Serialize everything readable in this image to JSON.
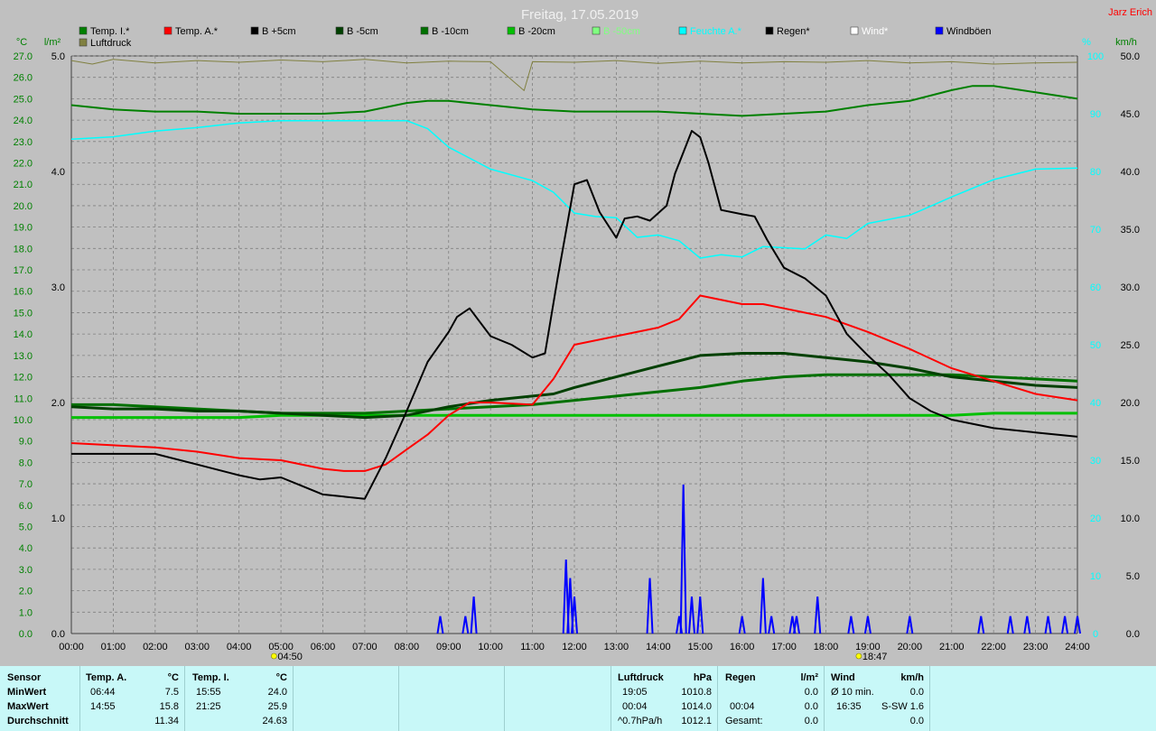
{
  "title": "Freitag, 17.05.2019",
  "author": "Jarz Erich",
  "axes": {
    "left_unit_temp": "°C",
    "left_unit_rain": "l/m²",
    "right_unit_pct": "%",
    "right_unit_kmh": "km/h",
    "temp_ticks": [
      "27.0",
      "26.0",
      "25.0",
      "24.0",
      "23.0",
      "22.0",
      "21.0",
      "20.0",
      "19.0",
      "18.0",
      "17.0",
      "16.0",
      "15.0",
      "14.0",
      "13.0",
      "12.0",
      "11.0",
      "10.0",
      "9.0",
      "8.0",
      "7.0",
      "6.0",
      "5.0",
      "4.0",
      "3.0",
      "2.0",
      "1.0",
      "0.0"
    ],
    "rain_ticks": [
      "5.0",
      "4.0",
      "3.0",
      "2.0",
      "1.0",
      "0.0"
    ],
    "pct_ticks": [
      "100",
      "90",
      "80",
      "70",
      "60",
      "50",
      "40",
      "30",
      "20",
      "10",
      "0"
    ],
    "kmh_ticks": [
      "50.0",
      "45.0",
      "40.0",
      "35.0",
      "30.0",
      "25.0",
      "20.0",
      "15.0",
      "10.0",
      "5.0",
      "0.0"
    ],
    "time_ticks": [
      "00:00",
      "01:00",
      "02:00",
      "03:00",
      "04:00",
      "05:00",
      "06:00",
      "07:00",
      "08:00",
      "09:00",
      "10:00",
      "11:00",
      "12:00",
      "13:00",
      "14:00",
      "15:00",
      "16:00",
      "17:00",
      "18:00",
      "19:00",
      "20:00",
      "21:00",
      "22:00",
      "23:00",
      "24:00"
    ],
    "sunrise": "04:50",
    "sunset": "18:47"
  },
  "legend": [
    {
      "label": "Temp. I.*",
      "color": "#008000"
    },
    {
      "label": "Temp. A.*",
      "color": "#ff0000"
    },
    {
      "label": "B +5cm",
      "color": "#000000"
    },
    {
      "label": "B -5cm",
      "color": "#004000"
    },
    {
      "label": "B -10cm",
      "color": "#007000"
    },
    {
      "label": "B -20cm",
      "color": "#00c000"
    },
    {
      "label": "B -50cm",
      "color": "#80ff80"
    },
    {
      "label": "Feuchte A.*",
      "color": "#00ffff"
    },
    {
      "label": "Regen*",
      "color": "#000000"
    },
    {
      "label": "Wind*",
      "color": "#ffffff"
    },
    {
      "label": "Windböen",
      "color": "#0000ff"
    },
    {
      "label": "Luftdruck",
      "color": "#808040"
    }
  ],
  "chart_data": {
    "type": "line",
    "x_unit": "hour",
    "xlim": [
      0,
      24
    ],
    "temp_ylim": [
      0,
      27
    ],
    "rain_ylim": [
      0,
      5
    ],
    "pct_ylim": [
      0,
      100
    ],
    "kmh_ylim": [
      0,
      50
    ],
    "series": [
      {
        "name": "Temp. I.*",
        "axis": "temp",
        "color": "#008000",
        "width": 2,
        "x": [
          0,
          1,
          2,
          3,
          4,
          5,
          6,
          7,
          8,
          8.5,
          9,
          10,
          11,
          12,
          13,
          14,
          15,
          16,
          17,
          18,
          19,
          20,
          21,
          21.5,
          22,
          23,
          24
        ],
        "y": [
          24.7,
          24.5,
          24.4,
          24.4,
          24.3,
          24.3,
          24.3,
          24.4,
          24.8,
          24.9,
          24.9,
          24.7,
          24.5,
          24.4,
          24.4,
          24.4,
          24.3,
          24.2,
          24.3,
          24.4,
          24.7,
          24.9,
          25.4,
          25.6,
          25.6,
          25.3,
          25.0
        ]
      },
      {
        "name": "Temp. A.*",
        "axis": "temp",
        "color": "#ff0000",
        "width": 2,
        "x": [
          0,
          1,
          2,
          3,
          4,
          5,
          6,
          6.5,
          7,
          7.5,
          8,
          8.5,
          9,
          9.5,
          10,
          11,
          11.5,
          12,
          13,
          14,
          14.5,
          15,
          16,
          16.5,
          17,
          18,
          19,
          20,
          21,
          22,
          23,
          24
        ],
        "y": [
          8.9,
          8.8,
          8.7,
          8.5,
          8.2,
          8.1,
          7.7,
          7.6,
          7.6,
          7.9,
          8.6,
          9.3,
          10.2,
          10.8,
          10.8,
          10.7,
          11.9,
          13.5,
          13.9,
          14.3,
          14.7,
          15.8,
          15.4,
          15.4,
          15.2,
          14.8,
          14.1,
          13.3,
          12.4,
          11.8,
          11.2,
          10.9
        ]
      },
      {
        "name": "B +5cm",
        "axis": "temp",
        "color": "#000000",
        "width": 2,
        "x": [
          0,
          1,
          2,
          3,
          4,
          4.5,
          5,
          5.5,
          6,
          6.5,
          7,
          7.5,
          8,
          8.5,
          9,
          9.2,
          9.5,
          10,
          10.5,
          11,
          11.3,
          11.6,
          12,
          12.3,
          12.6,
          13,
          13.2,
          13.5,
          13.8,
          14.2,
          14.4,
          14.6,
          14.8,
          15.0,
          15.2,
          15.5,
          16,
          16.3,
          16.6,
          17,
          17.5,
          18,
          18.5,
          19,
          19.5,
          20,
          20.5,
          21,
          22,
          23,
          24
        ],
        "y": [
          8.4,
          8.4,
          8.4,
          7.9,
          7.4,
          7.2,
          7.3,
          6.9,
          6.5,
          6.4,
          6.3,
          8.2,
          10.4,
          12.7,
          14.1,
          14.8,
          15.2,
          13.9,
          13.5,
          12.9,
          13.1,
          16.6,
          21.0,
          21.2,
          19.7,
          18.5,
          19.4,
          19.5,
          19.3,
          20.0,
          21.5,
          22.5,
          23.5,
          23.2,
          22.0,
          19.8,
          19.6,
          19.5,
          18.4,
          17.1,
          16.6,
          15.8,
          14.0,
          13.0,
          12.1,
          11.0,
          10.4,
          10.0,
          9.6,
          9.4,
          9.2
        ]
      },
      {
        "name": "B -5cm",
        "axis": "temp",
        "color": "#004000",
        "width": 3,
        "x": [
          0,
          1,
          2,
          3,
          4,
          5,
          6,
          7,
          8,
          9,
          10,
          11,
          11.5,
          12,
          13,
          14,
          15,
          16,
          17,
          18,
          19,
          20,
          21,
          22,
          23,
          24
        ],
        "y": [
          10.6,
          10.5,
          10.5,
          10.4,
          10.4,
          10.3,
          10.2,
          10.1,
          10.2,
          10.6,
          10.9,
          11.1,
          11.2,
          11.5,
          12.0,
          12.5,
          13.0,
          13.1,
          13.1,
          12.9,
          12.7,
          12.4,
          12.0,
          11.8,
          11.6,
          11.5
        ]
      },
      {
        "name": "B -10cm",
        "axis": "temp",
        "color": "#007000",
        "width": 3,
        "x": [
          0,
          1,
          2,
          3,
          4,
          5,
          6,
          7,
          8,
          9,
          10,
          11,
          12,
          13,
          14,
          15,
          16,
          17,
          18,
          19,
          20,
          21,
          22,
          23,
          24
        ],
        "y": [
          10.7,
          10.7,
          10.6,
          10.5,
          10.4,
          10.3,
          10.3,
          10.3,
          10.4,
          10.5,
          10.6,
          10.7,
          10.9,
          11.1,
          11.3,
          11.5,
          11.8,
          12.0,
          12.1,
          12.1,
          12.1,
          12.1,
          12.0,
          11.9,
          11.8
        ]
      },
      {
        "name": "B -20cm",
        "axis": "temp",
        "color": "#00c000",
        "width": 3,
        "x": [
          0,
          2,
          4,
          5,
          6,
          8,
          10,
          12,
          14,
          16,
          18,
          20,
          21,
          22,
          24
        ],
        "y": [
          10.1,
          10.1,
          10.1,
          10.2,
          10.2,
          10.2,
          10.2,
          10.2,
          10.2,
          10.2,
          10.2,
          10.2,
          10.2,
          10.3,
          10.3
        ]
      },
      {
        "name": "Feuchte A.*",
        "axis": "pct",
        "color": "#00ffff",
        "width": 1.5,
        "x": [
          0,
          1,
          2,
          3,
          4,
          5,
          6,
          7,
          8,
          8.5,
          9,
          10,
          11,
          11.5,
          12,
          12.5,
          13,
          13.5,
          14,
          14.5,
          15,
          15.5,
          16,
          16.5,
          17,
          17.5,
          18,
          18.5,
          19,
          20,
          21,
          22,
          23,
          24
        ],
        "y": [
          85.6,
          86,
          87,
          87.6,
          88.4,
          88.8,
          88.8,
          88.8,
          88.8,
          87.4,
          84.2,
          80.4,
          78.4,
          76.4,
          72.8,
          72.2,
          72.0,
          68.6,
          69.0,
          68.0,
          65.0,
          65.6,
          65.2,
          67.0,
          66.8,
          66.6,
          69.0,
          68.4,
          71.0,
          72.4,
          75.6,
          78.6,
          80.4,
          80.6
        ]
      },
      {
        "name": "Luftdruck",
        "axis": "pct",
        "color": "#808040",
        "width": 1,
        "x": [
          0,
          0.5,
          1,
          2,
          3,
          4,
          5,
          6,
          7,
          8,
          9,
          10,
          10.8,
          11,
          12,
          13,
          14,
          15,
          16,
          17,
          18,
          19,
          20,
          21,
          22,
          23,
          24
        ],
        "y": [
          99.2,
          98.6,
          99.4,
          98.8,
          99.2,
          98.9,
          99.3,
          99.0,
          99.4,
          98.8,
          99.1,
          99.0,
          94.0,
          99.0,
          98.9,
          99.2,
          98.7,
          99.1,
          98.8,
          99.0,
          98.9,
          99.2,
          98.8,
          99.0,
          98.6,
          98.8,
          98.9
        ]
      },
      {
        "name": "Windböen",
        "axis": "kmh",
        "color": "#0000ff",
        "width": 2,
        "type": "bar",
        "x": [
          8.8,
          9.4,
          9.6,
          11.8,
          11.9,
          12.0,
          13.8,
          14.5,
          14.6,
          14.8,
          15.0,
          16.0,
          16.5,
          16.7,
          17.2,
          17.3,
          17.8,
          18.6,
          19.0,
          20.0,
          21.7,
          22.4,
          22.8,
          23.3,
          23.7,
          24.0
        ],
        "y": [
          1.5,
          1.5,
          3.2,
          6.4,
          4.8,
          3.2,
          4.8,
          1.5,
          12.9,
          3.2,
          3.2,
          1.5,
          4.8,
          1.5,
          1.5,
          1.5,
          3.2,
          1.5,
          1.5,
          1.5,
          1.5,
          1.5,
          1.5,
          1.5,
          1.5,
          1.5
        ]
      }
    ]
  },
  "footer": {
    "sensor": {
      "header": "Sensor",
      "rows": [
        "MinWert",
        "MaxWert",
        "Durchschnitt"
      ]
    },
    "temp_a": {
      "header": "Temp. A.",
      "unit": "°C",
      "min_time": "06:44",
      "min": "7.5",
      "max_time": "14:55",
      "max": "15.8",
      "avg": "11.34"
    },
    "temp_i": {
      "header": "Temp. I.",
      "unit": "°C",
      "min_time": "15:55",
      "min": "24.0",
      "max_time": "21:25",
      "max": "25.9",
      "avg": "24.63"
    },
    "pressure": {
      "header": "Luftdruck",
      "unit": "hPa",
      "min_time": "19:05",
      "min": "1010.8",
      "max_time": "00:04",
      "max": "1014.0",
      "avg_label": "^0.7hPa/h",
      "avg": "1012.1"
    },
    "rain": {
      "header": "Regen",
      "unit": "l/m²",
      "min": "0.0",
      "max_time": "00:04",
      "max": "0.0",
      "total_label": "Gesamt:",
      "total": "0.0"
    },
    "wind": {
      "header": "Wind",
      "unit": "km/h",
      "min_label": "Ø 10 min.",
      "min": "0.0",
      "max_time": "16:35",
      "max_dir": "S-SW",
      "max": "1.6",
      "avg": "0.0"
    }
  }
}
